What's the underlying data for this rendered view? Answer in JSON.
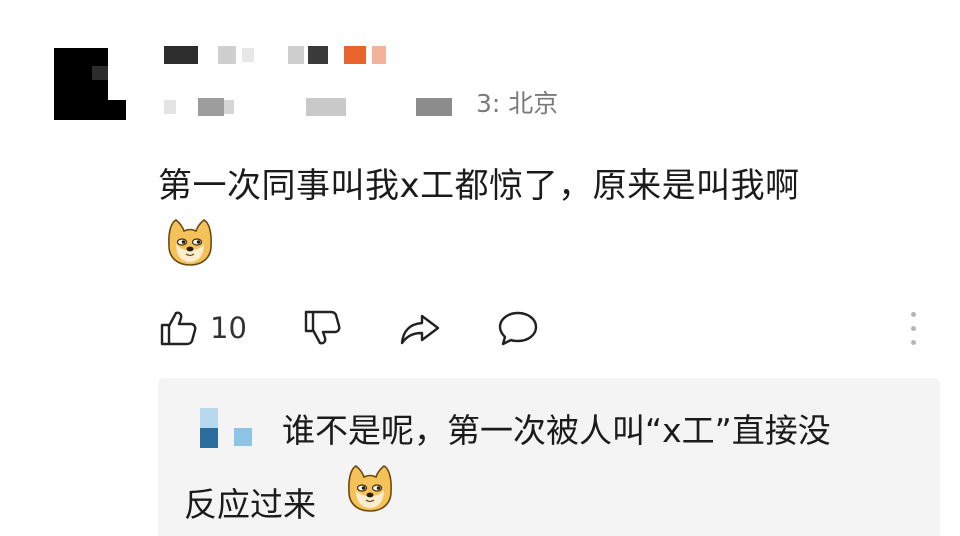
{
  "comment": {
    "location_label": "3: 北京",
    "text": "第一次同事叫我x工都惊了，原来是叫我啊",
    "emoji_icon": "doge-emoji",
    "likes": "10"
  },
  "reply": {
    "text_line1": "谁不是呢，第一次被人叫“x工”直接没",
    "text_line2": "反应过来",
    "emoji_icon": "doge-emoji"
  },
  "colors": {
    "reply_background": "#f4f4f5",
    "meta_text": "#7a7a7a",
    "icon_stroke": "#222222",
    "mosaic_orange": "#e8642a"
  }
}
